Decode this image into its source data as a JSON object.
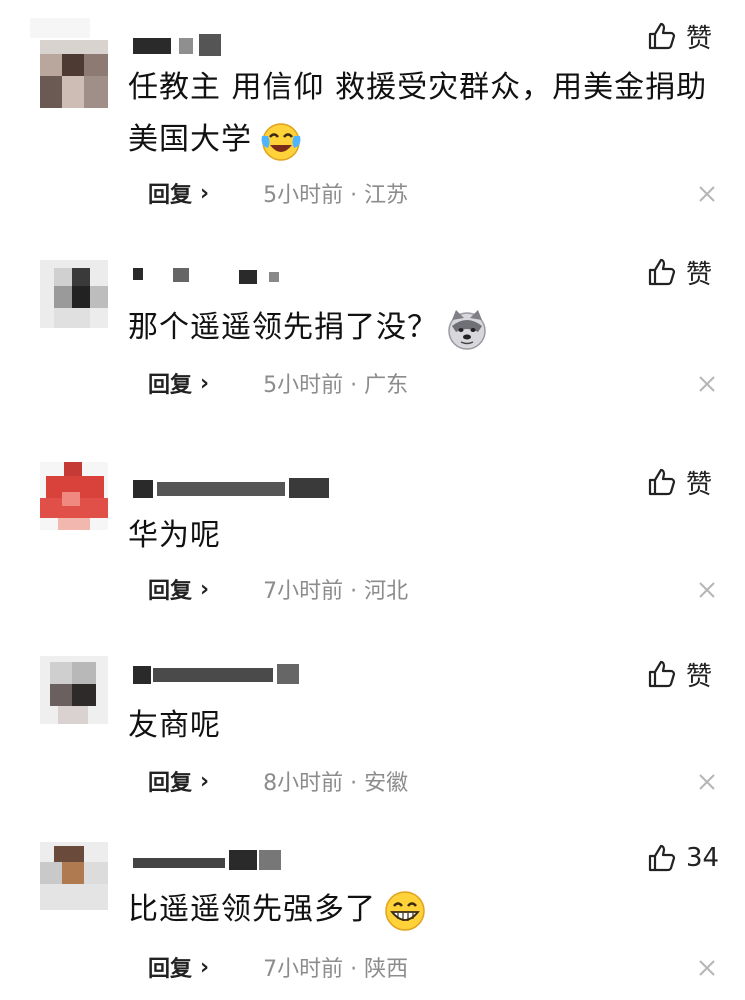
{
  "comments": [
    {
      "text": "任教主 用信仰 救援受灾群众，用美金捐助美国大学",
      "emoji": "laughing-crying-emoji",
      "like_label": "赞",
      "reply_label": "回复",
      "time": "5小时前",
      "location": "江苏"
    },
    {
      "text": "那个遥遥领先捐了没？",
      "emoji": "husky-dog-emoji",
      "like_label": "赞",
      "reply_label": "回复",
      "time": "5小时前",
      "location": "广东"
    },
    {
      "text": "华为呢",
      "emoji": "",
      "like_label": "赞",
      "reply_label": "回复",
      "time": "7小时前",
      "location": "河北"
    },
    {
      "text": "友商呢",
      "emoji": "",
      "like_label": "赞",
      "reply_label": "回复",
      "time": "8小时前",
      "location": "安徽"
    },
    {
      "text": "比遥遥领先强多了",
      "emoji": "grinning-emoji",
      "like_label": "34",
      "reply_label": "回复",
      "time": "7小时前",
      "location": "陕西"
    }
  ],
  "colors": {
    "text": "#111111",
    "meta": "#8c8c8c",
    "close": "#b5b5b5"
  }
}
